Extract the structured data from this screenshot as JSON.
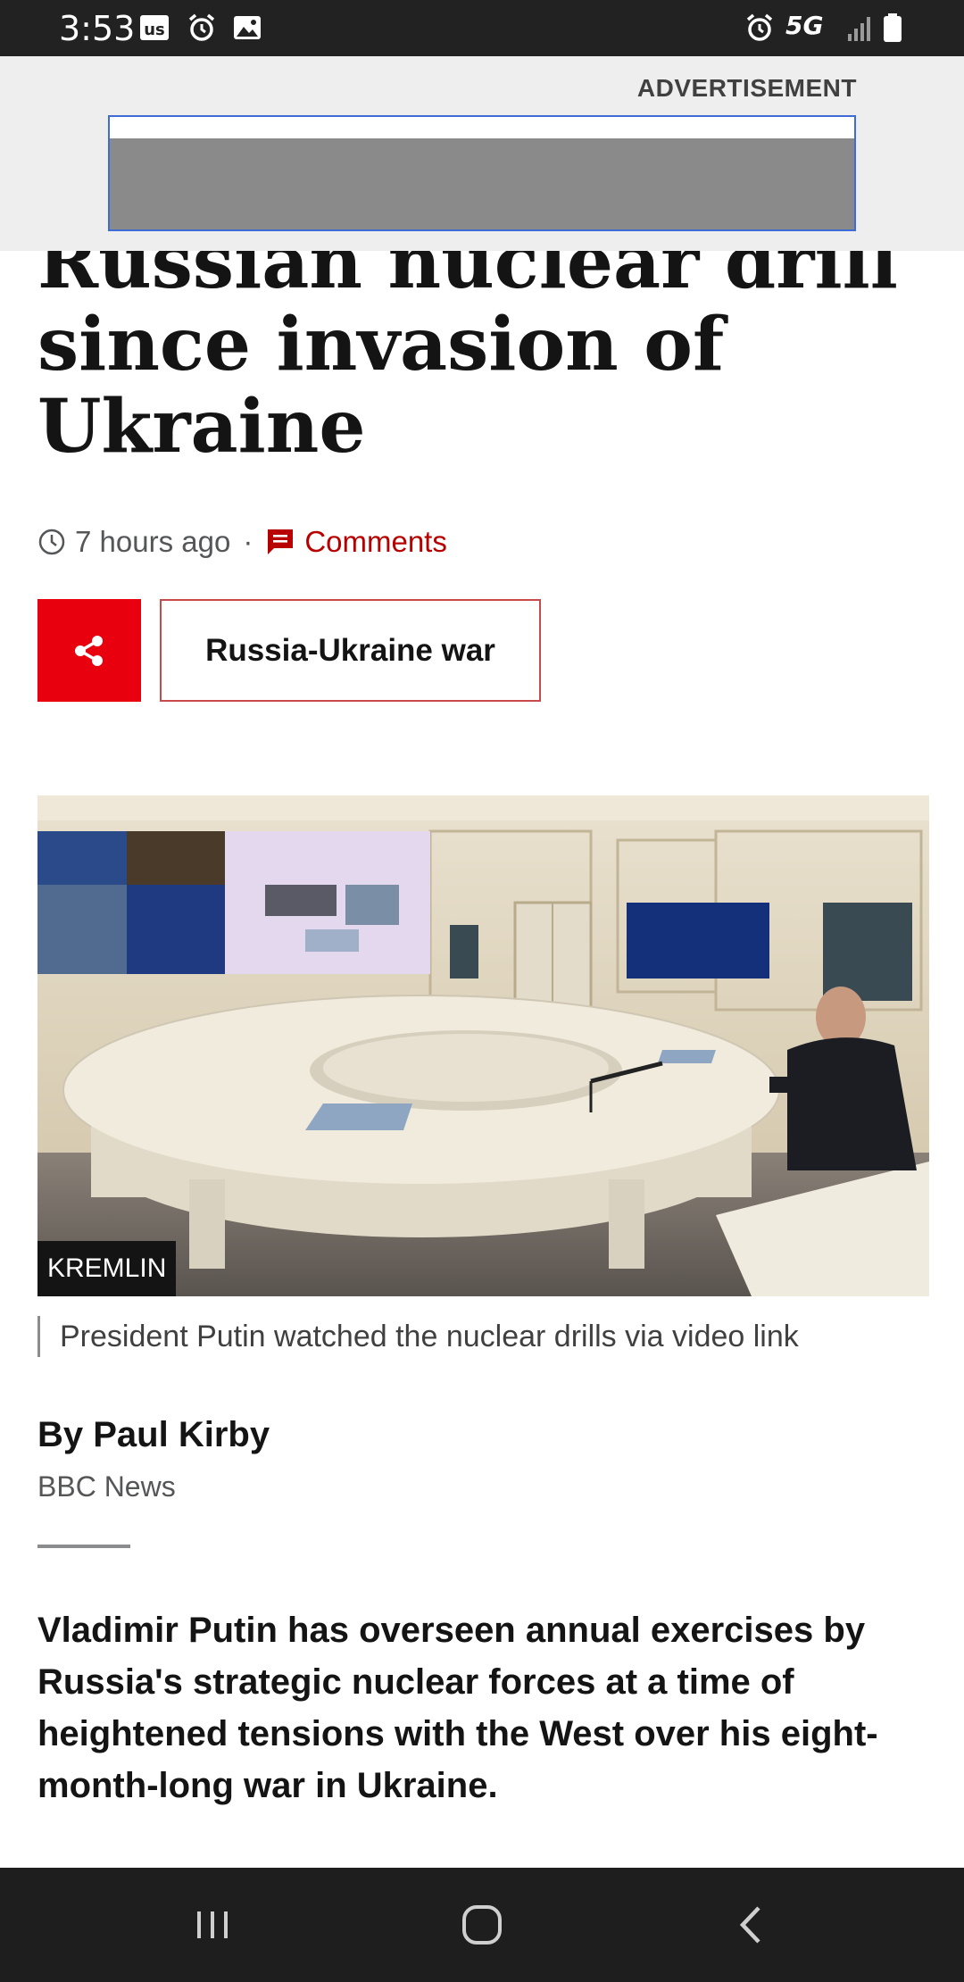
{
  "status_bar": {
    "time": "3:53",
    "network": "5G",
    "icons": [
      "us-badge-icon",
      "alarm-icon",
      "image-icon",
      "alarm-icon",
      "signal-icon",
      "battery-icon"
    ]
  },
  "ad": {
    "label": "ADVERTISEMENT"
  },
  "article": {
    "headline": "Russian nuclear drill since invasion of Ukraine",
    "time_ago": "7 hours ago",
    "separator": "·",
    "comments_label": "Comments",
    "topic_label": "Russia-Ukraine war",
    "image_credit": "KREMLIN",
    "image_caption": "President Putin watched the nuclear drills via video link",
    "byline": "By Paul Kirby",
    "byline_org": "BBC News",
    "lead": "Vladimir Putin has overseen annual exercises by Russia's strategic nuclear forces at a time of heightened tensions with the West over his eight-month-long war in Ukraine."
  },
  "colors": {
    "accent_red": "#b80000",
    "share_red": "#e8000f",
    "status_bar": "#222222",
    "nav_bar": "#1e1e1e"
  },
  "navbar": {
    "icons": [
      "recents-icon",
      "home-icon",
      "back-icon"
    ]
  }
}
